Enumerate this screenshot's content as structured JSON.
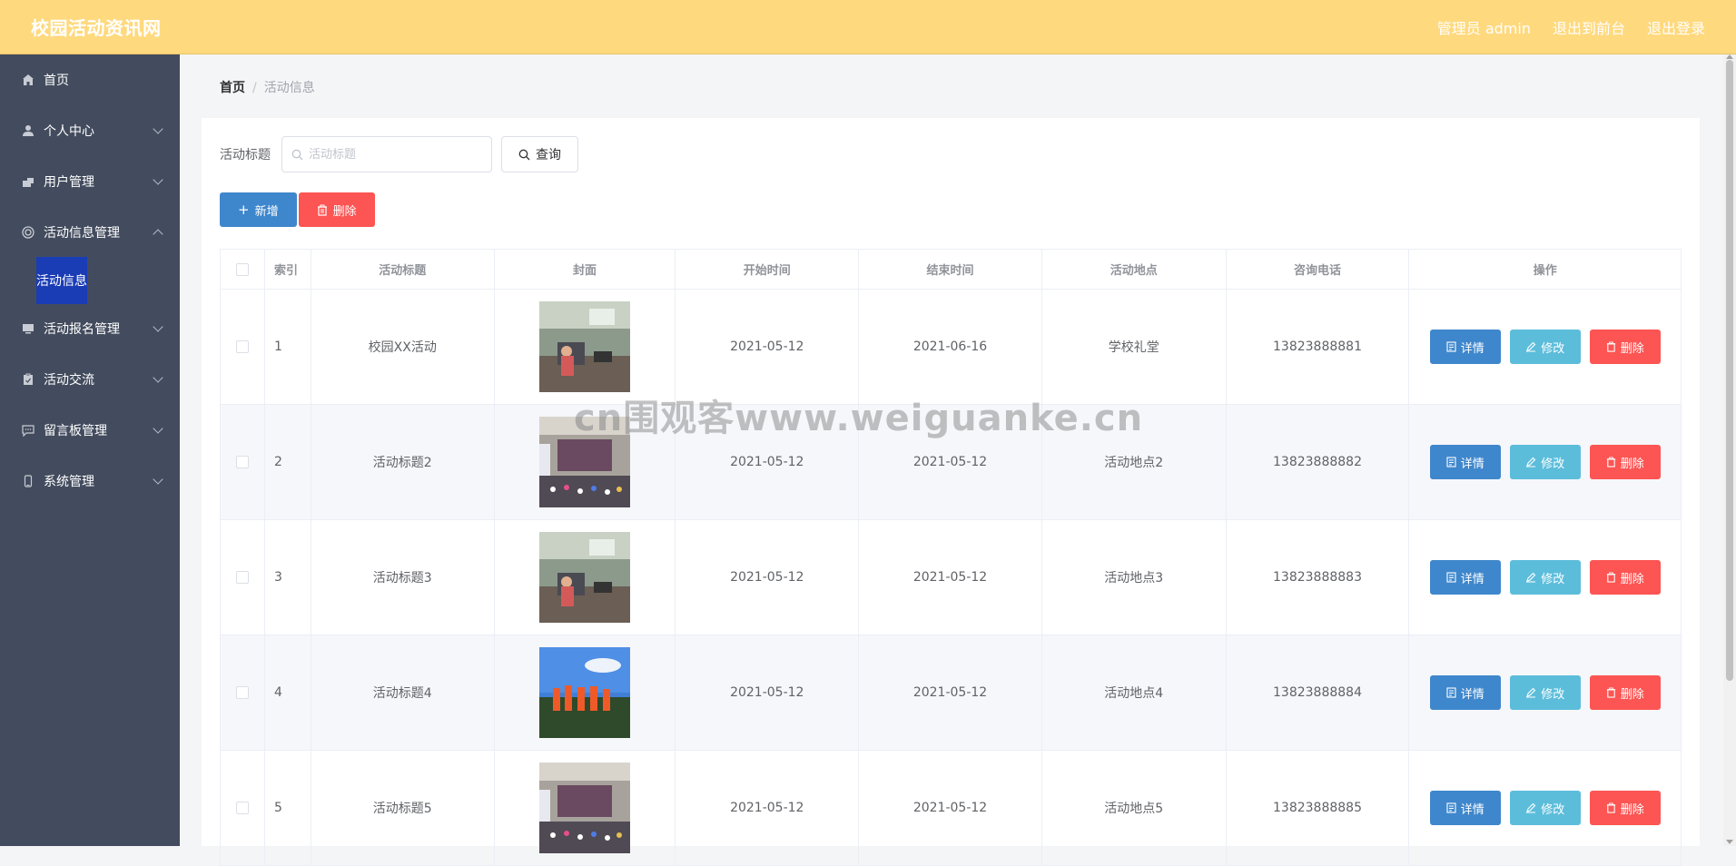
{
  "header": {
    "brand": "校园活动资讯网",
    "admin_label": "管理员 admin",
    "to_front": "退出到前台",
    "logout": "退出登录"
  },
  "sidebar": {
    "items": [
      {
        "label": "首页",
        "icon": "home-icon",
        "expandable": false
      },
      {
        "label": "个人中心",
        "icon": "user-icon",
        "expandable": true
      },
      {
        "label": "用户管理",
        "icon": "users-icon",
        "expandable": true
      },
      {
        "label": "活动信息管理",
        "icon": "target-icon",
        "expandable": true,
        "expanded": true
      },
      {
        "label": "活动报名管理",
        "icon": "monitor-icon",
        "expandable": true
      },
      {
        "label": "活动交流",
        "icon": "clipboard-icon",
        "expandable": true
      },
      {
        "label": "留言板管理",
        "icon": "message-icon",
        "expandable": true
      },
      {
        "label": "系统管理",
        "icon": "phone-icon",
        "expandable": true
      }
    ],
    "sub_item": "活动信息"
  },
  "breadcrumb": {
    "home": "首页",
    "separator": "/",
    "current": "活动信息"
  },
  "search": {
    "label": "活动标题",
    "placeholder": "活动标题",
    "button": "查询"
  },
  "actions": {
    "add": "新增",
    "delete": "删除"
  },
  "table": {
    "headers": [
      "索引",
      "活动标题",
      "封面",
      "开始时间",
      "结束时间",
      "活动地点",
      "咨询电话",
      "操作"
    ],
    "op_labels": {
      "detail": "详情",
      "edit": "修改",
      "delete": "删除"
    },
    "rows": [
      {
        "idx": "1",
        "title": "校园XX活动",
        "start": "2021-05-12",
        "end": "2021-06-16",
        "place": "学校礼堂",
        "phone": "13823888881",
        "cover": "classroom"
      },
      {
        "idx": "2",
        "title": "活动标题2",
        "start": "2021-05-12",
        "end": "2021-05-12",
        "place": "活动地点2",
        "phone": "13823888882",
        "cover": "hall"
      },
      {
        "idx": "3",
        "title": "活动标题3",
        "start": "2021-05-12",
        "end": "2021-05-12",
        "place": "活动地点3",
        "phone": "13823888883",
        "cover": "classroom"
      },
      {
        "idx": "4",
        "title": "活动标题4",
        "start": "2021-05-12",
        "end": "2021-05-12",
        "place": "活动地点4",
        "phone": "13823888884",
        "cover": "outdoor"
      },
      {
        "idx": "5",
        "title": "活动标题5",
        "start": "2021-05-12",
        "end": "2021-05-12",
        "place": "活动地点5",
        "phone": "13823888885",
        "cover": "hall"
      }
    ]
  },
  "watermark": "cn围观客www.weiguanke.cn",
  "colors": {
    "topbar": "#ffd97e",
    "sidebar": "#434c5e",
    "primary": "#3f87cc",
    "info": "#5cbddb",
    "danger": "#fc5553"
  }
}
